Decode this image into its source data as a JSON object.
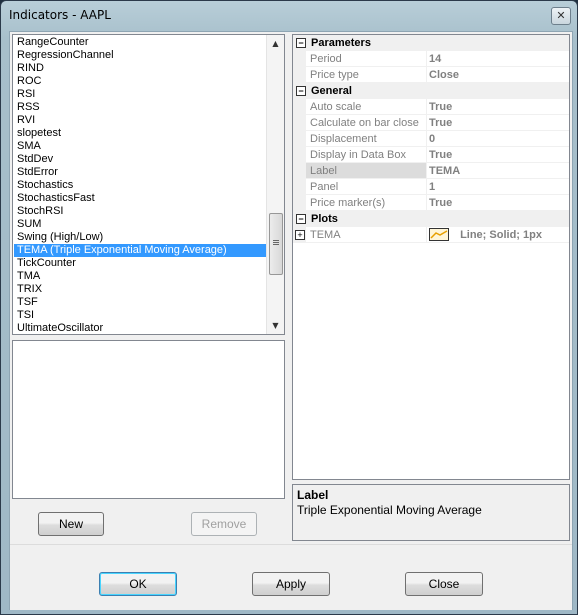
{
  "window": {
    "title": "Indicators - AAPL",
    "close_glyph": "✕"
  },
  "indicator_list": {
    "items": [
      "RangeCounter",
      "RegressionChannel",
      "RIND",
      "ROC",
      "RSI",
      "RSS",
      "RVI",
      "slopetest",
      "SMA",
      "StdDev",
      "StdError",
      "Stochastics",
      "StochasticsFast",
      "StochRSI",
      "SUM",
      "Swing (High/Low)",
      "TEMA (Triple Exponential Moving Average)",
      "TickCounter",
      "TMA",
      "TRIX",
      "TSF",
      "TSI",
      "UltimateOscillator"
    ],
    "selected_index": 16,
    "scroll_up": "▲",
    "scroll_down": "▼"
  },
  "left_buttons": {
    "new": "New",
    "remove": "Remove"
  },
  "properties": {
    "parameters": {
      "title": "Parameters",
      "toggle": "−",
      "rows": [
        {
          "name": "Period",
          "value": "14"
        },
        {
          "name": "Price type",
          "value": "Close"
        }
      ]
    },
    "general": {
      "title": "General",
      "toggle": "−",
      "rows": [
        {
          "name": "Auto scale",
          "value": "True"
        },
        {
          "name": "Calculate on bar close",
          "value": "True"
        },
        {
          "name": "Displacement",
          "value": "0"
        },
        {
          "name": "Display in Data Box",
          "value": "True"
        },
        {
          "name": "Label",
          "value": "TEMA"
        },
        {
          "name": "Panel",
          "value": "1"
        },
        {
          "name": "Price marker(s)",
          "value": "True"
        }
      ]
    },
    "plots": {
      "title": "Plots",
      "toggle": "−",
      "rows": [
        {
          "name": "TEMA",
          "value": "Line; Solid; 1px",
          "expander": "+"
        }
      ]
    }
  },
  "help": {
    "title": "Label",
    "description": "Triple Exponential Moving Average"
  },
  "dialog_buttons": {
    "ok": "OK",
    "apply": "Apply",
    "close": "Close"
  },
  "colors": {
    "selection": "#3399ff",
    "plot_line": "#e8a000"
  }
}
